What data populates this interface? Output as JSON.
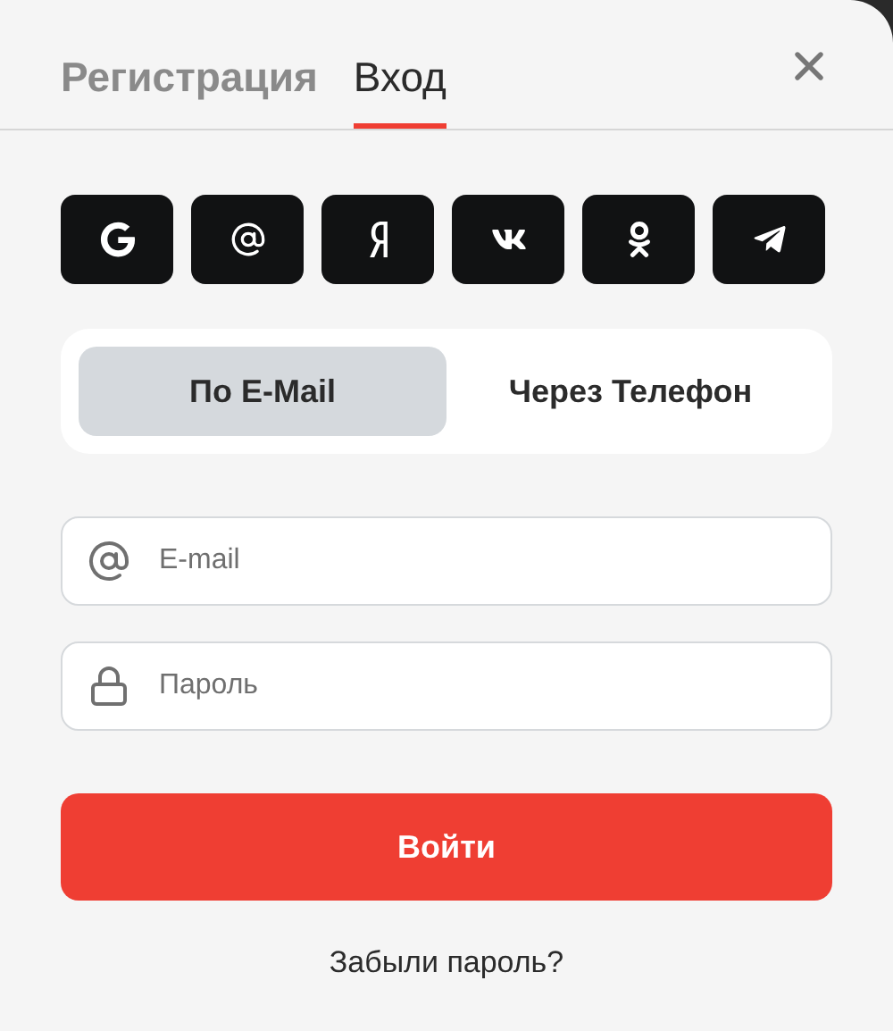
{
  "tabs": [
    {
      "label": "Регистрация",
      "selected": false
    },
    {
      "label": "Вход",
      "selected": true
    }
  ],
  "socials": [
    {
      "kind": "google"
    },
    {
      "kind": "at"
    },
    {
      "kind": "yandex"
    },
    {
      "kind": "vk"
    },
    {
      "kind": "ok"
    },
    {
      "kind": "telegram"
    }
  ],
  "methods": [
    {
      "label": "По E-Mail",
      "selected": true
    },
    {
      "label": "Через Телефон",
      "selected": false
    }
  ],
  "fields": [
    {
      "kind": "email",
      "placeholder": "E-mail"
    },
    {
      "kind": "password",
      "placeholder": "Пароль"
    }
  ],
  "submit": "Войти",
  "forgot": "Забыли пароль?"
}
